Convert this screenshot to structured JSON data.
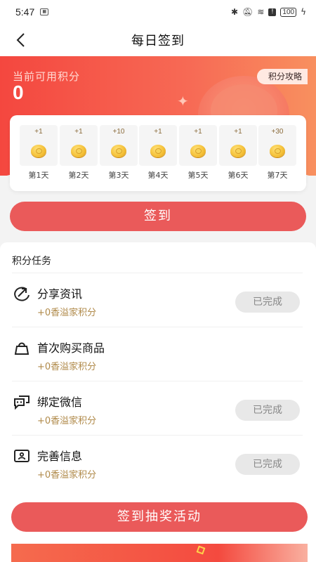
{
  "status_bar": {
    "time": "5:47",
    "battery": "100"
  },
  "nav": {
    "title": "每日签到"
  },
  "hero": {
    "points_label": "当前可用积分",
    "points_value": "0",
    "guide_label": "积分攻略"
  },
  "checkin": {
    "days": [
      {
        "bonus": "+1",
        "label": "第1天"
      },
      {
        "bonus": "+1",
        "label": "第2天"
      },
      {
        "bonus": "+10",
        "label": "第3天"
      },
      {
        "bonus": "+1",
        "label": "第4天"
      },
      {
        "bonus": "+1",
        "label": "第5天"
      },
      {
        "bonus": "+1",
        "label": "第6天"
      },
      {
        "bonus": "+30",
        "label": "第7天"
      }
    ],
    "button_label": "签到"
  },
  "tasks": {
    "title": "积分任务",
    "items": [
      {
        "name": "分享资讯",
        "reward": "+0香溢家积分",
        "status": "已完成",
        "icon": "share-icon"
      },
      {
        "name": "首次购买商品",
        "reward": "+0香溢家积分",
        "status": "",
        "icon": "shopping-bag-icon"
      },
      {
        "name": "绑定微信",
        "reward": "+0香溢家积分",
        "status": "已完成",
        "icon": "wechat-chat-icon"
      },
      {
        "name": "完善信息",
        "reward": "+0香溢家积分",
        "status": "已完成",
        "icon": "profile-card-icon"
      }
    ]
  },
  "lottery": {
    "button_label": "签到抽奖活动"
  }
}
